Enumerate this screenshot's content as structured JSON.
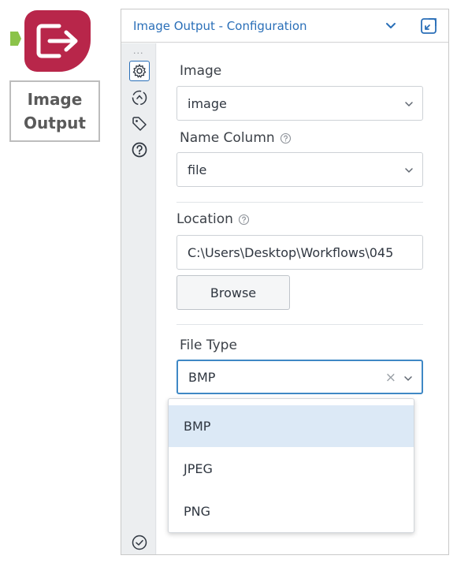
{
  "tool": {
    "label_line1": "Image",
    "label_line2": "Output",
    "color": "#b8264a",
    "icon": "output-arrow-icon"
  },
  "panel": {
    "title": "Image Output - Configuration",
    "accent": "#2a6fb8"
  },
  "rail": {
    "dots": "...",
    "items": [
      "gear-icon",
      "connection-icon",
      "tag-icon",
      "help-icon"
    ],
    "bottom": "check-circle-icon"
  },
  "fields": {
    "image": {
      "label": "Image",
      "value": "image"
    },
    "name_column": {
      "label": "Name Column",
      "value": "file"
    },
    "location": {
      "label": "Location",
      "value": "C:\\Users\\Desktop\\Workflows\\045"
    },
    "browse_label": "Browse",
    "file_type": {
      "label": "File Type",
      "value": "BMP",
      "clear": "×"
    }
  },
  "dropdown": {
    "options": [
      "BMP",
      "JPEG",
      "PNG"
    ],
    "selected": "BMP"
  }
}
